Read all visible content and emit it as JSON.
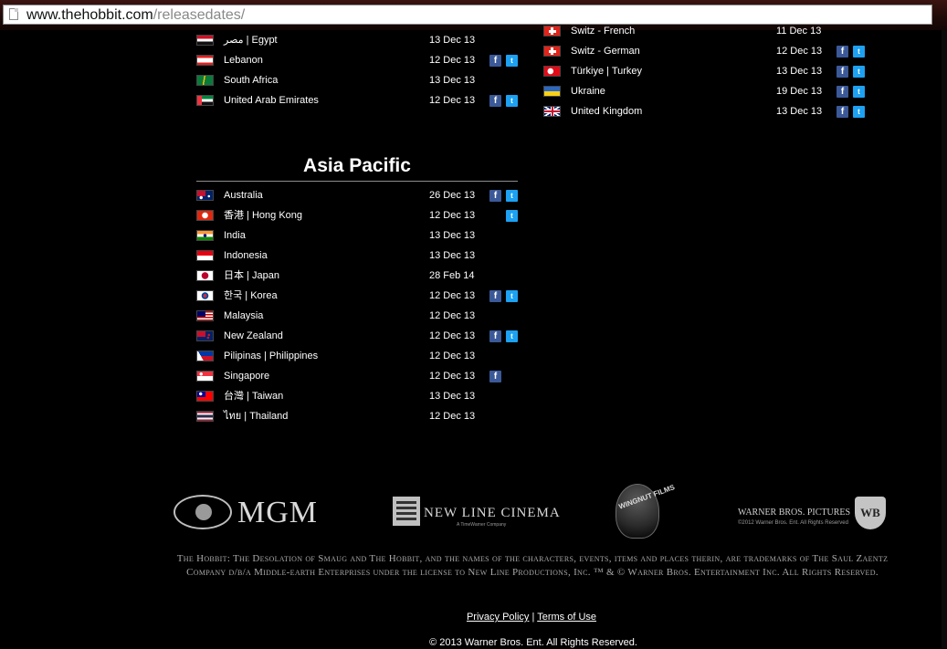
{
  "browser": {
    "url_host": "www.thehobbit.com",
    "url_path": "/releasedates/"
  },
  "colors": {
    "background": "#000000",
    "facebook": "#3b5998",
    "twitter": "#1da1f2"
  },
  "middle_east_africa": [
    {
      "name": "مصر | Egypt",
      "date": "13 Dec 13",
      "facebook": false,
      "twitter": false,
      "flag": "egypt-flag-icon"
    },
    {
      "name": "Lebanon",
      "date": "12 Dec 13",
      "facebook": true,
      "twitter": true,
      "flag": "lebanon-flag-icon"
    },
    {
      "name": "South Africa",
      "date": "13 Dec 13",
      "facebook": false,
      "twitter": false,
      "flag": "south-africa-flag-icon"
    },
    {
      "name": "United Arab Emirates",
      "date": "12 Dec 13",
      "facebook": true,
      "twitter": true,
      "flag": "uae-flag-icon"
    }
  ],
  "europe": [
    {
      "name": "Switz - French",
      "date": "11 Dec 13",
      "facebook": false,
      "twitter": false,
      "flag": "swiss-flag-icon"
    },
    {
      "name": "Switz - German",
      "date": "12 Dec 13",
      "facebook": true,
      "twitter": true,
      "flag": "swiss-flag-icon"
    },
    {
      "name": "Türkiye | Turkey",
      "date": "13 Dec 13",
      "facebook": true,
      "twitter": true,
      "flag": "turkey-flag-icon"
    },
    {
      "name": "Ukraine",
      "date": "19 Dec 13",
      "facebook": true,
      "twitter": true,
      "flag": "ukraine-flag-icon"
    },
    {
      "name": "United Kingdom",
      "date": "13 Dec 13",
      "facebook": true,
      "twitter": true,
      "flag": "uk-flag-icon"
    }
  ],
  "asia_pacific": {
    "heading": "Asia Pacific",
    "rows": [
      {
        "name": "Australia",
        "date": "26 Dec 13",
        "facebook": true,
        "twitter": true,
        "flag": "australia-flag-icon"
      },
      {
        "name": "香港 | Hong Kong",
        "date": "12 Dec 13",
        "facebook": false,
        "twitter": true,
        "flag": "hong-kong-flag-icon"
      },
      {
        "name": "India",
        "date": "13 Dec 13",
        "facebook": false,
        "twitter": false,
        "flag": "india-flag-icon"
      },
      {
        "name": "Indonesia",
        "date": "13 Dec 13",
        "facebook": false,
        "twitter": false,
        "flag": "indonesia-flag-icon"
      },
      {
        "name": "日本 | Japan",
        "date": "28 Feb 14",
        "facebook": false,
        "twitter": false,
        "flag": "japan-flag-icon"
      },
      {
        "name": "한국 | Korea",
        "date": "12 Dec 13",
        "facebook": true,
        "twitter": true,
        "flag": "korea-flag-icon"
      },
      {
        "name": "Malaysia",
        "date": "12 Dec 13",
        "facebook": false,
        "twitter": false,
        "flag": "malaysia-flag-icon"
      },
      {
        "name": "New Zealand",
        "date": "12 Dec 13",
        "facebook": true,
        "twitter": true,
        "flag": "new-zealand-flag-icon"
      },
      {
        "name": "Pilipinas | Philippines",
        "date": "12 Dec 13",
        "facebook": false,
        "twitter": false,
        "flag": "philippines-flag-icon"
      },
      {
        "name": "Singapore",
        "date": "12 Dec 13",
        "facebook": true,
        "twitter": false,
        "flag": "singapore-flag-icon"
      },
      {
        "name": "台灣 | Taiwan",
        "date": "13 Dec 13",
        "facebook": false,
        "twitter": false,
        "flag": "taiwan-flag-icon"
      },
      {
        "name": "ไทย | Thailand",
        "date": "12 Dec 13",
        "facebook": false,
        "twitter": false,
        "flag": "thailand-flag-icon"
      }
    ]
  },
  "icons": {
    "facebook": "f",
    "twitter": "t"
  },
  "logos": {
    "mgm": "MGM",
    "new_line": "NEW LINE CINEMA",
    "new_line_sub": "A TimeWarner Company",
    "wingnut": "WINGNUT FILMS",
    "warner": "WARNER BROS. PICTURES",
    "warner_sub": "©2012 Warner Bros. Ent. All Rights Reserved",
    "wb_shield": "WB"
  },
  "legal_text": "The Hobbit: The Desolation of Smaug and The Hobbit, and the names of the characters, events, items and places therin, are trademarks of The Saul Zaentz Company d/b/a Middle-earth Enterprises under the license to New Line Productions, Inc. ™ & © Warner Bros. Entertainment Inc. All Rights Reserved.",
  "footer": {
    "privacy": "Privacy Policy",
    "separator": "|",
    "terms": "Terms of Use",
    "copyright": "© 2013 Warner Bros. Ent. All Rights Reserved."
  }
}
